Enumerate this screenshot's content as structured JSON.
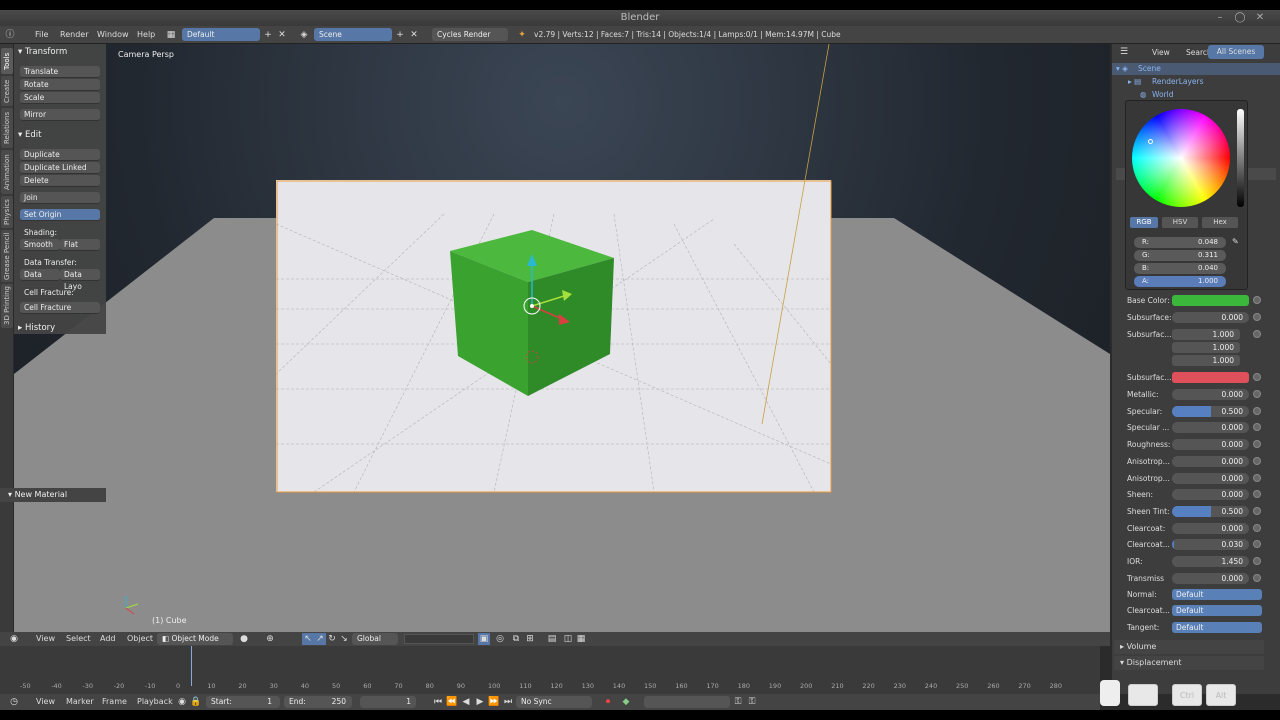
{
  "window": {
    "title": "Blender"
  },
  "info_header": {
    "menus": [
      "File",
      "Render",
      "Window",
      "Help"
    ],
    "screen_layout": "Default",
    "scene": "Scene",
    "engine": "Cycles Render",
    "stats": "v2.79 | Verts:12 | Faces:7 | Tris:14 | Objects:1/4 | Lamps:0/1 | Mem:14.97M | Cube"
  },
  "vertical_tabs": [
    "Tools",
    "Create",
    "Relations",
    "Animation",
    "Physics",
    "Grease Pencil",
    "3D Printing"
  ],
  "tool_shelf": {
    "transform_header": "Transform",
    "transform": [
      "Translate",
      "Rotate",
      "Scale"
    ],
    "mirror": "Mirror",
    "edit_header": "Edit",
    "edit": [
      "Duplicate",
      "Duplicate Linked",
      "Delete"
    ],
    "join": "Join",
    "set_origin": "Set Origin",
    "shading_label": "Shading:",
    "smooth": "Smooth",
    "flat": "Flat",
    "data_transfer_label": "Data Transfer:",
    "data": "Data",
    "data_layo": "Data Layo",
    "cell_fracture_label": "Cell Fracture:",
    "cell_fracture": "Cell Fracture",
    "history": "History"
  },
  "operator_panel": {
    "title": "New Material"
  },
  "viewport": {
    "label": "Camera Persp",
    "object_label": "(1) Cube"
  },
  "view3d_header": {
    "menus": [
      "View",
      "Select",
      "Add",
      "Object"
    ],
    "mode": "Object Mode",
    "orientation": "Global"
  },
  "timeline": {
    "ticks": [
      "-50",
      "-40",
      "-30",
      "-20",
      "-10",
      "0",
      "10",
      "20",
      "30",
      "40",
      "50",
      "60",
      "70",
      "80",
      "90",
      "100",
      "110",
      "120",
      "130",
      "140",
      "150",
      "160",
      "170",
      "180",
      "190",
      "200",
      "210",
      "220",
      "230",
      "240",
      "250",
      "260",
      "270",
      "280"
    ],
    "menus": [
      "View",
      "Marker",
      "Frame",
      "Playback"
    ],
    "start_label": "Start:",
    "start": "1",
    "end_label": "End:",
    "end": "250",
    "current": "1",
    "sync": "No Sync"
  },
  "outliner": {
    "tabs": [
      "View",
      "Search",
      "All Scenes"
    ],
    "items": [
      "Scene",
      "RenderLayers",
      "World"
    ]
  },
  "color_picker": {
    "modes": [
      "RGB",
      "HSV",
      "Hex"
    ],
    "r_label": "R:",
    "r": "0.048",
    "g_label": "G:",
    "g": "0.311",
    "b_label": "B:",
    "b": "0.040",
    "a_label": "A:",
    "a": "1.000",
    "base_color_swatch": "#3bb83b"
  },
  "material": {
    "base_color_label": "Base Color:",
    "subsurface_label": "Subsurface:",
    "subsurface": "0.000",
    "subsurface_radius_label": "Subsurfac...",
    "subsurface_radius": [
      "1.000",
      "1.000",
      "1.000"
    ],
    "subsurface_color_label": "Subsurfac...",
    "subsurface_color": "#e0505a",
    "rows": [
      {
        "label": "Metallic:",
        "value": "0.000",
        "fill": 0
      },
      {
        "label": "Specular:",
        "value": "0.500",
        "fill": 0.5
      },
      {
        "label": "Specular ...",
        "value": "0.000",
        "fill": 0
      },
      {
        "label": "Roughness:",
        "value": "0.000",
        "fill": 0
      },
      {
        "label": "Anisotrop...",
        "value": "0.000",
        "fill": 0
      },
      {
        "label": "Anisotrop...",
        "value": "0.000",
        "fill": 0
      },
      {
        "label": "Sheen:",
        "value": "0.000",
        "fill": 0
      },
      {
        "label": "Sheen Tint:",
        "value": "0.500",
        "fill": 0.5
      },
      {
        "label": "Clearcoat:",
        "value": "0.000",
        "fill": 0
      },
      {
        "label": "Clearcoat...",
        "value": "0.030",
        "fill": 0.03
      },
      {
        "label": "IOR:",
        "value": "1.450",
        "fill": 0
      },
      {
        "label": "Transmiss",
        "value": "0.000",
        "fill": 0
      }
    ],
    "normal_label": "Normal:",
    "normal": "Default",
    "clearcoat_normal_label": "Clearcoat...",
    "clearcoat_normal": "Default",
    "tangent_label": "Tangent:",
    "tangent": "Default",
    "volume": "Volume",
    "displacement": "Displacement"
  },
  "key_overlay": {
    "ctrl": "Ctrl",
    "alt": "Alt"
  }
}
